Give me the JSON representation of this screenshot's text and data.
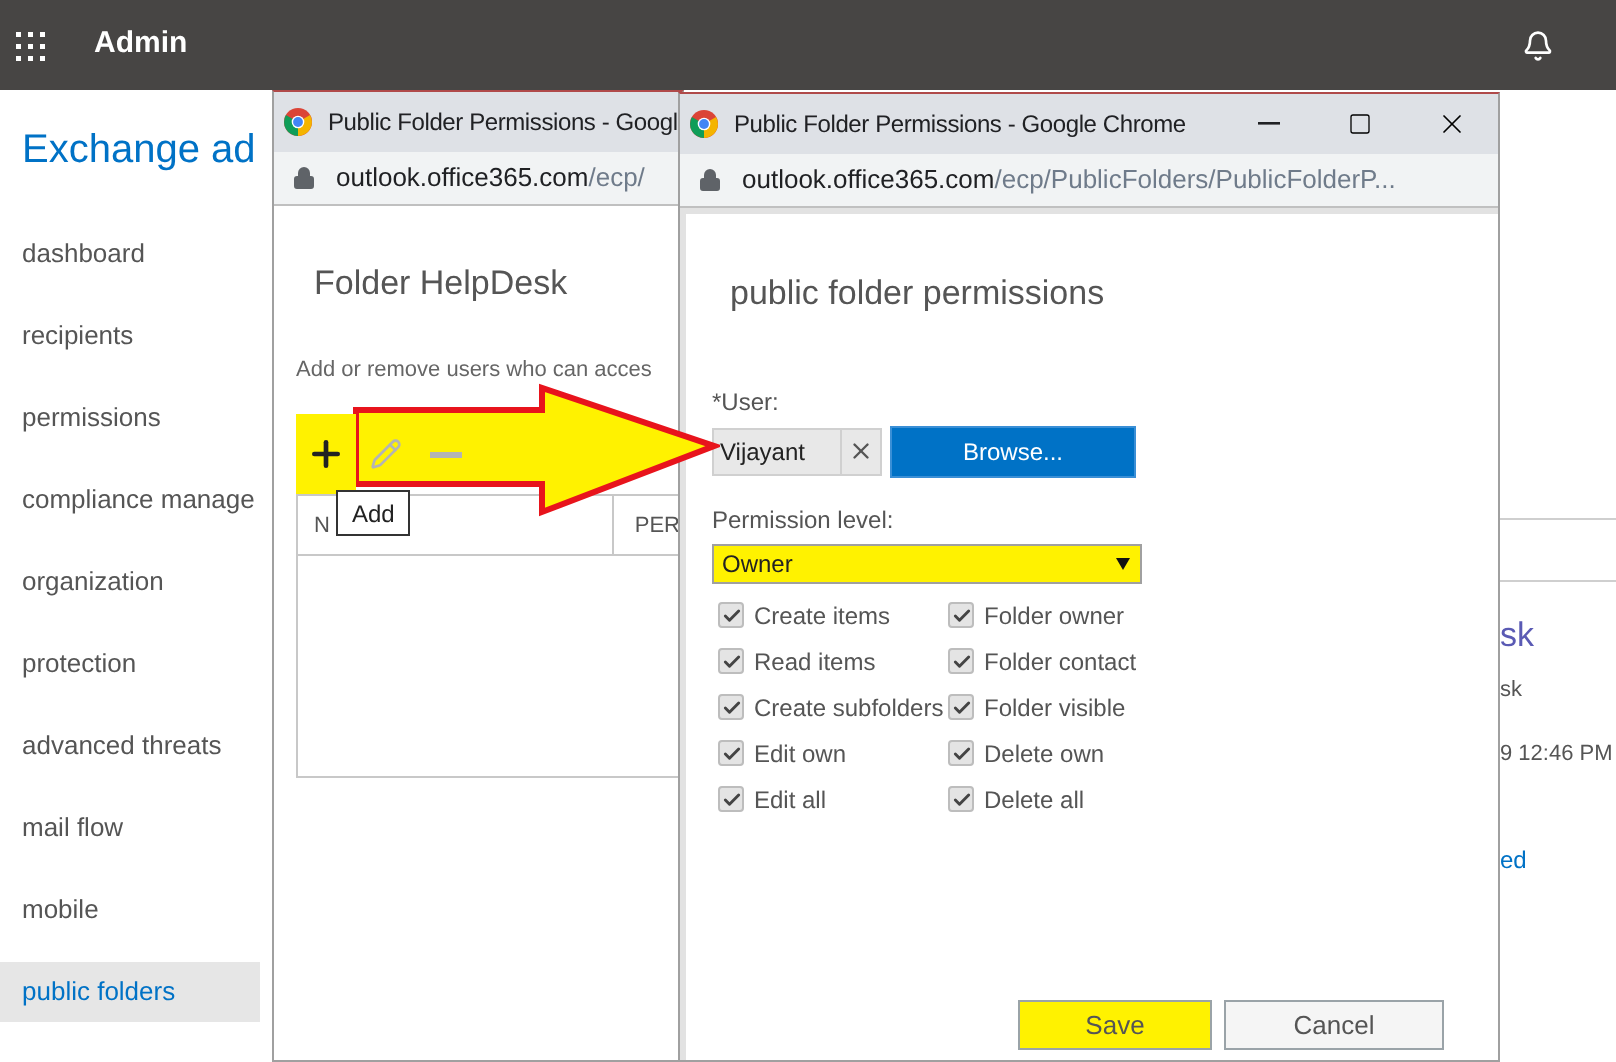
{
  "top_bar": {
    "title": "Admin"
  },
  "sidebar": {
    "title": "Exchange ad",
    "items": [
      {
        "label": "dashboard",
        "selected": false
      },
      {
        "label": "recipients",
        "selected": false
      },
      {
        "label": "permissions",
        "selected": false
      },
      {
        "label": "compliance manage",
        "selected": false
      },
      {
        "label": "organization",
        "selected": false
      },
      {
        "label": "protection",
        "selected": false
      },
      {
        "label": "advanced threats",
        "selected": false
      },
      {
        "label": "mail flow",
        "selected": false
      },
      {
        "label": "mobile",
        "selected": false
      },
      {
        "label": "public folders",
        "selected": true
      }
    ]
  },
  "details": {
    "texts": [
      {
        "text": "sk",
        "kind": "heading"
      },
      {
        "text": "sk",
        "kind": "plain"
      },
      {
        "text": "9 12:46 PM",
        "kind": "plain"
      },
      {
        "text": "ed",
        "kind": "link"
      }
    ]
  },
  "back_window": {
    "title": "Public Folder Permissions - Googl",
    "url_host": "outlook.office365.com",
    "url_path": "/ecp/",
    "heading": "Folder HelpDesk",
    "description": "Add or remove users who can acces",
    "toolbar": [
      {
        "kind": "add",
        "disabled": false,
        "highlighted": true
      },
      {
        "kind": "edit",
        "disabled": true,
        "highlighted": false
      },
      {
        "kind": "remove",
        "disabled": true,
        "highlighted": false
      }
    ],
    "tooltip": "Add",
    "columns": [
      "N",
      "PER"
    ]
  },
  "front_window": {
    "title": "Public Folder Permissions - Google Chrome",
    "url_host": "outlook.office365.com",
    "url_path": "/ecp/PublicFolders/PublicFolderP...",
    "heading": "public folder permissions",
    "user_label": "*User:",
    "user_value": "Vijayant",
    "browse": "Browse...",
    "level_label": "Permission level:",
    "level": {
      "value": "Owner",
      "highlighted": true
    },
    "permissions": [
      {
        "label": "Create items",
        "checked": true
      },
      {
        "label": "Folder owner",
        "checked": true
      },
      {
        "label": "Read items",
        "checked": true
      },
      {
        "label": "Folder contact",
        "checked": true
      },
      {
        "label": "Create subfolders",
        "checked": true
      },
      {
        "label": "Folder visible",
        "checked": true
      },
      {
        "label": "Edit own",
        "checked": true
      },
      {
        "label": "Delete own",
        "checked": true
      },
      {
        "label": "Edit all",
        "checked": true
      },
      {
        "label": "Delete all",
        "checked": true
      }
    ],
    "buttons": [
      {
        "label": "Save",
        "kind": "primary",
        "highlighted": true
      },
      {
        "label": "Cancel",
        "kind": "secondary",
        "highlighted": false
      }
    ]
  }
}
